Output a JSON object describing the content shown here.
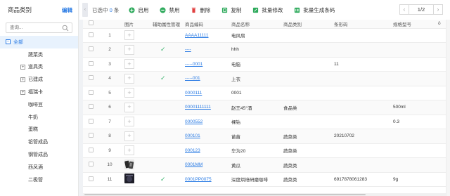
{
  "sidebar": {
    "title": "商品类别",
    "edit_label": "编辑",
    "search_placeholder": "查询...",
    "items": [
      {
        "label": "全部",
        "toggle": "−",
        "selected": true
      },
      {
        "label": "蔬菜类",
        "toggle": ""
      },
      {
        "label": "道具类",
        "toggle": "+"
      },
      {
        "label": "已建成",
        "toggle": "+"
      },
      {
        "label": "福瑞卡",
        "toggle": "+"
      },
      {
        "label": "咖啡豆",
        "toggle": ""
      },
      {
        "label": "牛奶",
        "toggle": ""
      },
      {
        "label": "蛋糕",
        "toggle": ""
      },
      {
        "label": "铅管成品",
        "toggle": ""
      },
      {
        "label": "钢管成品",
        "toggle": ""
      },
      {
        "label": "西凤酒",
        "toggle": ""
      },
      {
        "label": "二极管",
        "toggle": ""
      }
    ]
  },
  "toolbar": {
    "collapse_icon": "‹",
    "selected_prefix": "已选中",
    "selected_count": "0",
    "selected_suffix": "条",
    "buttons": [
      {
        "label": "启用",
        "icon": "plus-circle-icon",
        "color": "#2eaa5c"
      },
      {
        "label": "禁用",
        "icon": "ban-icon",
        "color": "#2eaa5c"
      },
      {
        "label": "删除",
        "icon": "trash-icon",
        "color": "#e04040"
      },
      {
        "label": "复制",
        "icon": "copy-icon",
        "color": "#2eaa5c"
      },
      {
        "label": "批量修改",
        "icon": "batch-edit-icon",
        "color": "#2eaa5c"
      },
      {
        "label": "批量生成条码",
        "icon": "barcode-icon",
        "color": "#2eaa5c"
      }
    ],
    "pager": {
      "prev": "‹",
      "pages": "1/2",
      "next": "›"
    }
  },
  "table": {
    "columns": [
      "",
      "",
      "图片",
      "辅助属性管理",
      "商品编码",
      "商品名称",
      "商品类别",
      "条形码",
      "规格型号",
      "ō"
    ],
    "rows": [
      {
        "no": "1",
        "img": "placeholder",
        "aux": "",
        "code": "AAAA11111",
        "name": "电风扇",
        "category": "",
        "barcode": "",
        "spec": ""
      },
      {
        "no": "2",
        "img": "placeholder",
        "aux": "✓",
        "code": "----",
        "name": "hhh",
        "category": "",
        "barcode": "",
        "spec": ""
      },
      {
        "no": "3",
        "img": "placeholder",
        "aux": "",
        "code": "-----0001",
        "name": "电脑",
        "category": "",
        "barcode": "11",
        "spec": ""
      },
      {
        "no": "4",
        "img": "placeholder",
        "aux": "✓",
        "code": "-----001",
        "name": "上衣",
        "category": "",
        "barcode": "",
        "spec": ""
      },
      {
        "no": "5",
        "img": "placeholder",
        "aux": "",
        "code": "0000111",
        "name": "0001",
        "category": "",
        "barcode": "",
        "spec": ""
      },
      {
        "no": "6",
        "img": "placeholder",
        "aux": "",
        "code": "00001111111",
        "name": "赵王45°酒",
        "category": "食品类",
        "barcode": "",
        "spec": "500ml"
      },
      {
        "no": "7",
        "img": "placeholder",
        "aux": "",
        "code": "0000552",
        "name": "裸钻",
        "category": "",
        "barcode": "",
        "spec": "0.3"
      },
      {
        "no": "8",
        "img": "placeholder",
        "aux": "",
        "code": "000101",
        "name": "苗苗",
        "category": "蔬菜类",
        "barcode": "20210702",
        "spec": ""
      },
      {
        "no": "9",
        "img": "placeholder",
        "aux": "",
        "code": "000123",
        "name": "华为20",
        "category": "蔬菜类",
        "barcode": "",
        "spec": ""
      },
      {
        "no": "10",
        "img": "photo-phone",
        "aux": "",
        "code": "0001MM",
        "name": "黄瓜",
        "category": "蔬菜类",
        "barcode": "",
        "spec": ""
      },
      {
        "no": "11",
        "img": "photo-dark",
        "aux": "✓",
        "code": "0001PP0075",
        "name": "深度烘焙研磨咖啡",
        "category": "蔬菜类",
        "barcode": "6917878061283",
        "spec": "9g"
      }
    ]
  },
  "colors": {
    "accent": "#2a7be4",
    "success": "#2eaa5c",
    "danger": "#e04040"
  }
}
